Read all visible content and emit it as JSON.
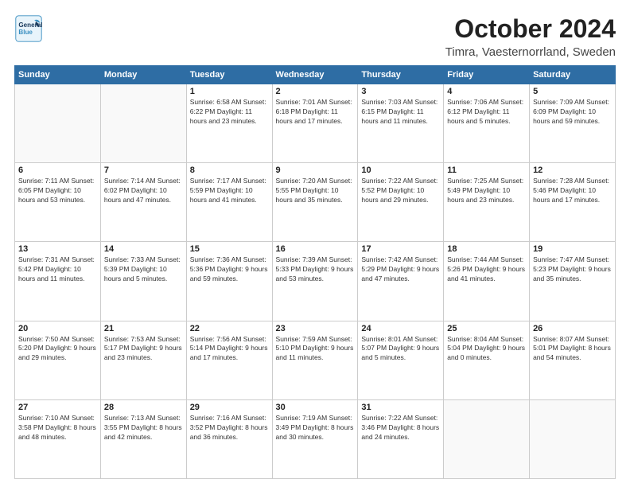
{
  "header": {
    "logo_general": "General",
    "logo_blue": "Blue",
    "month": "October 2024",
    "location": "Timra, Vaesternorrland, Sweden"
  },
  "days_of_week": [
    "Sunday",
    "Monday",
    "Tuesday",
    "Wednesday",
    "Thursday",
    "Friday",
    "Saturday"
  ],
  "weeks": [
    [
      {
        "day": "",
        "info": ""
      },
      {
        "day": "",
        "info": ""
      },
      {
        "day": "1",
        "info": "Sunrise: 6:58 AM\nSunset: 6:22 PM\nDaylight: 11 hours\nand 23 minutes."
      },
      {
        "day": "2",
        "info": "Sunrise: 7:01 AM\nSunset: 6:18 PM\nDaylight: 11 hours\nand 17 minutes."
      },
      {
        "day": "3",
        "info": "Sunrise: 7:03 AM\nSunset: 6:15 PM\nDaylight: 11 hours\nand 11 minutes."
      },
      {
        "day": "4",
        "info": "Sunrise: 7:06 AM\nSunset: 6:12 PM\nDaylight: 11 hours\nand 5 minutes."
      },
      {
        "day": "5",
        "info": "Sunrise: 7:09 AM\nSunset: 6:09 PM\nDaylight: 10 hours\nand 59 minutes."
      }
    ],
    [
      {
        "day": "6",
        "info": "Sunrise: 7:11 AM\nSunset: 6:05 PM\nDaylight: 10 hours\nand 53 minutes."
      },
      {
        "day": "7",
        "info": "Sunrise: 7:14 AM\nSunset: 6:02 PM\nDaylight: 10 hours\nand 47 minutes."
      },
      {
        "day": "8",
        "info": "Sunrise: 7:17 AM\nSunset: 5:59 PM\nDaylight: 10 hours\nand 41 minutes."
      },
      {
        "day": "9",
        "info": "Sunrise: 7:20 AM\nSunset: 5:55 PM\nDaylight: 10 hours\nand 35 minutes."
      },
      {
        "day": "10",
        "info": "Sunrise: 7:22 AM\nSunset: 5:52 PM\nDaylight: 10 hours\nand 29 minutes."
      },
      {
        "day": "11",
        "info": "Sunrise: 7:25 AM\nSunset: 5:49 PM\nDaylight: 10 hours\nand 23 minutes."
      },
      {
        "day": "12",
        "info": "Sunrise: 7:28 AM\nSunset: 5:46 PM\nDaylight: 10 hours\nand 17 minutes."
      }
    ],
    [
      {
        "day": "13",
        "info": "Sunrise: 7:31 AM\nSunset: 5:42 PM\nDaylight: 10 hours\nand 11 minutes."
      },
      {
        "day": "14",
        "info": "Sunrise: 7:33 AM\nSunset: 5:39 PM\nDaylight: 10 hours\nand 5 minutes."
      },
      {
        "day": "15",
        "info": "Sunrise: 7:36 AM\nSunset: 5:36 PM\nDaylight: 9 hours\nand 59 minutes."
      },
      {
        "day": "16",
        "info": "Sunrise: 7:39 AM\nSunset: 5:33 PM\nDaylight: 9 hours\nand 53 minutes."
      },
      {
        "day": "17",
        "info": "Sunrise: 7:42 AM\nSunset: 5:29 PM\nDaylight: 9 hours\nand 47 minutes."
      },
      {
        "day": "18",
        "info": "Sunrise: 7:44 AM\nSunset: 5:26 PM\nDaylight: 9 hours\nand 41 minutes."
      },
      {
        "day": "19",
        "info": "Sunrise: 7:47 AM\nSunset: 5:23 PM\nDaylight: 9 hours\nand 35 minutes."
      }
    ],
    [
      {
        "day": "20",
        "info": "Sunrise: 7:50 AM\nSunset: 5:20 PM\nDaylight: 9 hours\nand 29 minutes."
      },
      {
        "day": "21",
        "info": "Sunrise: 7:53 AM\nSunset: 5:17 PM\nDaylight: 9 hours\nand 23 minutes."
      },
      {
        "day": "22",
        "info": "Sunrise: 7:56 AM\nSunset: 5:14 PM\nDaylight: 9 hours\nand 17 minutes."
      },
      {
        "day": "23",
        "info": "Sunrise: 7:59 AM\nSunset: 5:10 PM\nDaylight: 9 hours\nand 11 minutes."
      },
      {
        "day": "24",
        "info": "Sunrise: 8:01 AM\nSunset: 5:07 PM\nDaylight: 9 hours\nand 5 minutes."
      },
      {
        "day": "25",
        "info": "Sunrise: 8:04 AM\nSunset: 5:04 PM\nDaylight: 9 hours\nand 0 minutes."
      },
      {
        "day": "26",
        "info": "Sunrise: 8:07 AM\nSunset: 5:01 PM\nDaylight: 8 hours\nand 54 minutes."
      }
    ],
    [
      {
        "day": "27",
        "info": "Sunrise: 7:10 AM\nSunset: 3:58 PM\nDaylight: 8 hours\nand 48 minutes."
      },
      {
        "day": "28",
        "info": "Sunrise: 7:13 AM\nSunset: 3:55 PM\nDaylight: 8 hours\nand 42 minutes."
      },
      {
        "day": "29",
        "info": "Sunrise: 7:16 AM\nSunset: 3:52 PM\nDaylight: 8 hours\nand 36 minutes."
      },
      {
        "day": "30",
        "info": "Sunrise: 7:19 AM\nSunset: 3:49 PM\nDaylight: 8 hours\nand 30 minutes."
      },
      {
        "day": "31",
        "info": "Sunrise: 7:22 AM\nSunset: 3:46 PM\nDaylight: 8 hours\nand 24 minutes."
      },
      {
        "day": "",
        "info": ""
      },
      {
        "day": "",
        "info": ""
      }
    ]
  ]
}
